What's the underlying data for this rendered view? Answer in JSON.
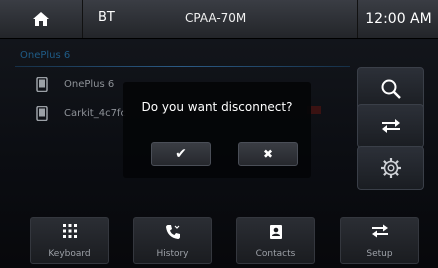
{
  "header": {
    "bt_label": "BT",
    "title": "CPAA-70M",
    "time": "12:00 AM"
  },
  "devices": {
    "section_label": "OnePlus 6",
    "items": [
      {
        "name": "OnePlus 6"
      },
      {
        "name": "Carkit_4c7fc"
      }
    ]
  },
  "dialog": {
    "message": "Do you want disconnect?",
    "confirm_glyph": "✔",
    "cancel_glyph": "✖"
  },
  "nav": {
    "items": [
      {
        "label": "Keyboard"
      },
      {
        "label": "History"
      },
      {
        "label": "Contacts"
      },
      {
        "label": "Setup"
      }
    ]
  },
  "colors": {
    "accent": "#1f5b86",
    "dialog_bg": "#040508"
  }
}
